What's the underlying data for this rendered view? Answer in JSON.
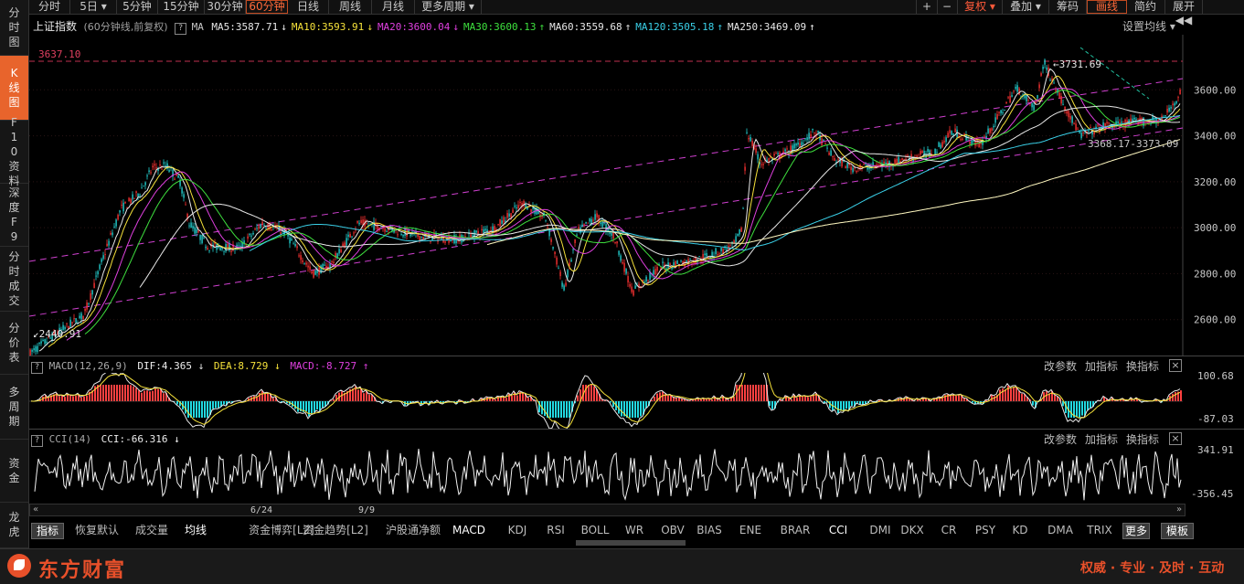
{
  "sidebar": {
    "items": [
      {
        "label": "分时图"
      },
      {
        "label": "K线图"
      },
      {
        "label": "F10资料"
      },
      {
        "label": "深度F9"
      },
      {
        "label": "分时成交"
      },
      {
        "label": "分价表"
      },
      {
        "label": "多周期"
      },
      {
        "label": "资金"
      },
      {
        "label": "龙虎"
      }
    ]
  },
  "toolbar": {
    "periods": [
      "分时",
      "5日 ▾",
      "5分钟",
      "15分钟",
      "30分钟",
      "60分钟",
      "日线",
      "周线",
      "月线",
      "更多周期 ▾"
    ],
    "active_period": "60分钟",
    "plus": "+",
    "minus": "−",
    "fuquan": "复权 ▾",
    "overlay": "叠加 ▾",
    "chips": "筹码",
    "draw_line": "画线",
    "simple": "简约",
    "expand": "展开 ◀◀"
  },
  "main_chart": {
    "title": "上证指数",
    "subtitle": "(60分钟线,前复权)",
    "help": "?",
    "ma_label": "MA",
    "ma": [
      {
        "label": "MA5:3587.71",
        "arrow": "↓",
        "color": "#e8e8e8"
      },
      {
        "label": "MA10:3593.91",
        "arrow": "↓",
        "color": "#f5e13a"
      },
      {
        "label": "MA20:3600.04",
        "arrow": "↓",
        "color": "#e040e0"
      },
      {
        "label": "MA30:3600.13",
        "arrow": "↑",
        "color": "#3ee03e"
      },
      {
        "label": "MA60:3559.68",
        "arrow": "↑",
        "color": "#e8e8e8"
      },
      {
        "label": "MA120:3505.18",
        "arrow": "↑",
        "color": "#3ad0e8"
      },
      {
        "label": "MA250:3469.09",
        "arrow": "↑",
        "color": "#e8e8e8"
      }
    ],
    "set_ma": "设置均线 ▾",
    "ref_line_label": "3637.10",
    "high_label": "3731.69",
    "low_label": "2440.91",
    "range_label": "3368.17-3373.09",
    "y_ticks": [
      "3600.00",
      "3400.00",
      "3200.00",
      "3000.00",
      "2800.00",
      "2600.00"
    ],
    "colors": {
      "up": "#ff3333",
      "down": "#22d0d0",
      "trend": "#d040d0"
    }
  },
  "macd": {
    "name": "MACD(12,26,9)",
    "dif": "DIF:4.365",
    "dif_arrow": "↓",
    "dea": "DEA:8.729",
    "dea_arrow": "↓",
    "macd": "MACD:-8.727",
    "macd_arrow": "↑",
    "buttons": [
      "改参数",
      "加指标",
      "换指标"
    ],
    "close": "×",
    "y_top": "100.68",
    "y_bottom": "-87.03"
  },
  "cci": {
    "name": "CCI(14)",
    "value": "CCI:-66.316",
    "arrow": "↓",
    "buttons": [
      "改参数",
      "加指标",
      "换指标"
    ],
    "close": "×",
    "y_top": "341.91",
    "y_bottom": "-356.45"
  },
  "date_axis": [
    "6/24",
    "9/9"
  ],
  "tabs": [
    "指标",
    "恢复默认",
    "成交量",
    "均线",
    "资金博弈[L2]",
    "资金趋势[L2]",
    "沪股通净额",
    "MACD",
    "KDJ",
    "RSI",
    "BOLL",
    "WR",
    "OBV",
    "BIAS",
    "ENE",
    "BRAR",
    "CCI",
    "DMI",
    "DKX",
    "CR",
    "PSY",
    "KD",
    "DMA",
    "TRIX",
    "更多",
    "模板"
  ],
  "footer": {
    "brand": "东方财富",
    "slogan": "权威 · 专业 · 及时 · 互动"
  }
}
